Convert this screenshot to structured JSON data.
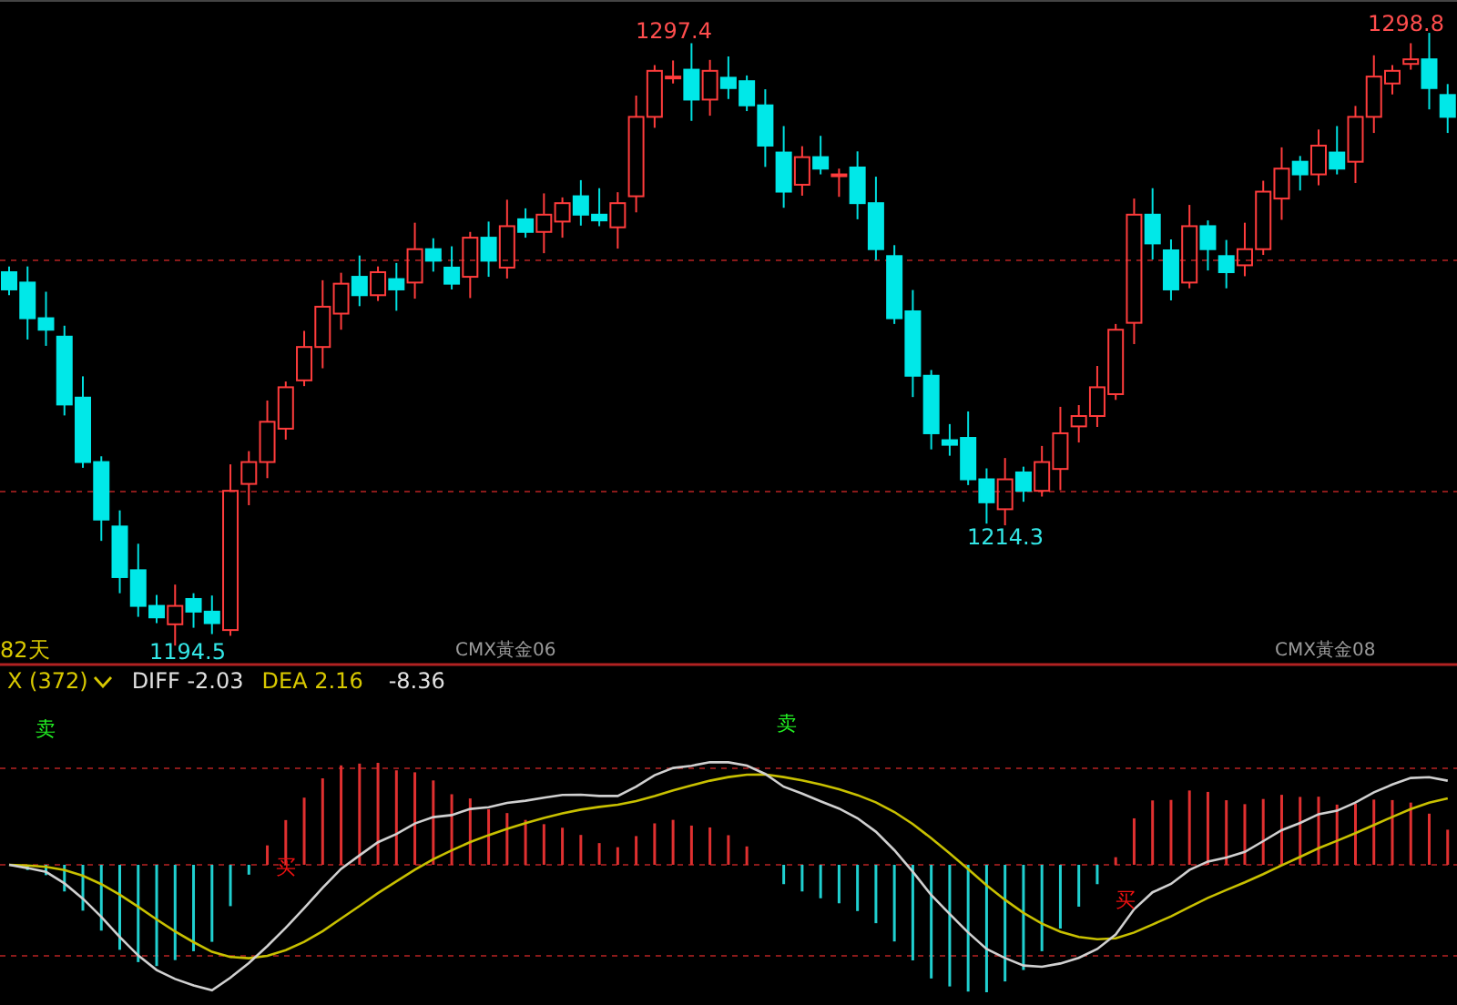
{
  "price_panel": {
    "extreme_labels": [
      {
        "text": "1297.4",
        "kind": "high"
      },
      {
        "text": "1298.8",
        "kind": "high"
      },
      {
        "text": "1214.3",
        "kind": "low"
      },
      {
        "text": "1194.5",
        "kind": "low"
      }
    ],
    "period_label": "82天",
    "contract_labels": [
      "CMX黃金06",
      "CMX黃金08"
    ]
  },
  "macd_panel": {
    "indicator_name": "X (372)",
    "diff": "DIFF -2.03",
    "dea": "DEA 2.16",
    "macd": "-8.36",
    "signals": [
      {
        "text": "卖",
        "kind": "sell"
      },
      {
        "text": "买",
        "kind": "buy"
      },
      {
        "text": "卖",
        "kind": "sell"
      },
      {
        "text": "买",
        "kind": "buy"
      }
    ]
  }
}
